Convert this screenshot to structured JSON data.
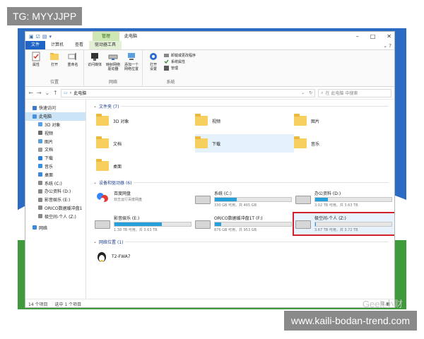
{
  "overlay": {
    "tg": "TG: MYYJJPP",
    "site": "www.kaili-bodan-trend.com",
    "watermark": "Geek小财"
  },
  "titlebar": {
    "manage": "管理",
    "title": "此电脑"
  },
  "tabs": {
    "file": "文件",
    "computer": "计算机",
    "view": "查看",
    "drive_tools": "驱动器工具"
  },
  "ribbon": {
    "location": {
      "label": "位置",
      "props": "属性",
      "open": "打开",
      "rename": "重命名"
    },
    "network": {
      "label": "网络",
      "media": "访问媒体",
      "map_drive": "映射网络\n驱动器",
      "add_location": "添加一个\n网络位置"
    },
    "system": {
      "label": "系统",
      "open_settings": "打开\n设置",
      "uninstall": "卸载或更改程序",
      "sys_props": "系统属性",
      "manage": "管理"
    }
  },
  "address": {
    "path": "此电脑",
    "search_placeholder": "在 此电脑 中搜索"
  },
  "nav": {
    "items": [
      {
        "label": "快速访问",
        "sub": false,
        "color": "#3a78c8"
      },
      {
        "label": "此电脑",
        "sub": false,
        "color": "#4a90d9",
        "selected": true
      },
      {
        "label": "3D 对象",
        "sub": true,
        "color": "#59a0e8"
      },
      {
        "label": "视频",
        "sub": true,
        "color": "#6a6a6a"
      },
      {
        "label": "图片",
        "sub": true,
        "color": "#5aa0d8"
      },
      {
        "label": "文档",
        "sub": true,
        "color": "#9a9a9a"
      },
      {
        "label": "下载",
        "sub": true,
        "color": "#2f7fd8"
      },
      {
        "label": "音乐",
        "sub": true,
        "color": "#3b8fe0"
      },
      {
        "label": "桌面",
        "sub": true,
        "color": "#3a88d8"
      },
      {
        "label": "系统 (C:)",
        "sub": true,
        "color": "#888888"
      },
      {
        "label": "办公资料 (D:)",
        "sub": true,
        "color": "#888888"
      },
      {
        "label": "影音娱乐 (E:)",
        "sub": true,
        "color": "#888888"
      },
      {
        "label": "ORICO数据缓冲盘1",
        "sub": true,
        "color": "#888888"
      },
      {
        "label": "极空间-个人 (Z:)",
        "sub": true,
        "color": "#888888"
      },
      {
        "label": "网络",
        "sub": false,
        "color": "#3a88d8"
      }
    ]
  },
  "sections": {
    "folders_hdr": "文件夹 (7)",
    "devices_hdr": "设备和驱动器 (6)",
    "network_hdr": "网络位置 (1)"
  },
  "folders": [
    {
      "name": "3D 对象"
    },
    {
      "name": "视频"
    },
    {
      "name": "图片"
    },
    {
      "name": "文档"
    },
    {
      "name": "下载",
      "highlight": true
    },
    {
      "name": "音乐"
    },
    {
      "name": "桌面"
    }
  ],
  "drives": [
    {
      "name": "百度网盘",
      "sub": "双击运行百度网盘",
      "type": "app"
    },
    {
      "name": "系统 (C:)",
      "sub": "330 GB 可用，共 465 GB",
      "usage": 0.29
    },
    {
      "name": "办公资料 (D:)",
      "sub": "3.02 TB 可用，共 3.63 TB",
      "usage": 0.17
    },
    {
      "name": "影音娱乐 (E:)",
      "sub": "1.38 TB 可用，共 3.63 TB",
      "usage": 0.62
    },
    {
      "name": "ORICO数据缓冲盘1T (F:)",
      "sub": "876 GB 可用，共 953 GB",
      "usage": 0.08
    },
    {
      "name": "极空间-个人 (Z:)",
      "sub": "3.67 TB 可用，共 3.72 TB",
      "usage": 0.01,
      "highlight": true
    }
  ],
  "network": [
    {
      "name": "T2-FWA7"
    }
  ],
  "status": {
    "count": "14 个项目",
    "selected": "选中 1 个项目"
  }
}
